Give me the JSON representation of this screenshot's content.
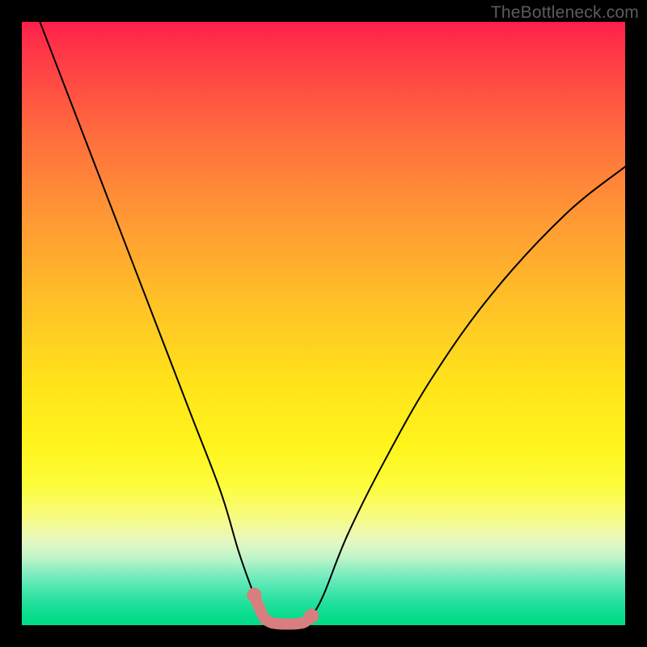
{
  "watermark": "TheBottleneck.com",
  "chart_data": {
    "type": "line",
    "title": "",
    "xlabel": "",
    "ylabel": "",
    "xlim": [
      0,
      100
    ],
    "ylim": [
      0,
      100
    ],
    "grid": false,
    "legend": false,
    "series": [
      {
        "name": "bottleneck-curve",
        "color": "#000000",
        "x": [
          3,
          8,
          13,
          18,
          23,
          28,
          33,
          36,
          38.5,
          40,
          41,
          42,
          44,
          46,
          47,
          48,
          50,
          54,
          60,
          68,
          78,
          90,
          100
        ],
        "y": [
          100,
          87,
          74,
          61,
          48,
          35,
          22,
          12,
          5,
          1.5,
          0.6,
          0.3,
          0.2,
          0.3,
          0.6,
          1.5,
          5,
          15,
          27,
          41,
          55,
          68,
          76
        ]
      },
      {
        "name": "highlight-band",
        "color": "#d87e7e",
        "x": [
          38.5,
          40,
          41,
          42,
          44,
          46,
          47,
          48
        ],
        "y": [
          5,
          1.5,
          0.6,
          0.3,
          0.2,
          0.3,
          0.6,
          1.5
        ]
      }
    ],
    "annotations": []
  }
}
